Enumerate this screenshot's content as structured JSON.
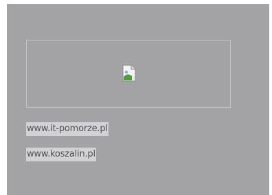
{
  "banner": {
    "image_icon": "broken-image-icon"
  },
  "links": [
    {
      "label": "www.it-pomorze.pl"
    },
    {
      "label": "www.koszalin.pl"
    }
  ],
  "colors": {
    "panel_background": "#a3a3a6",
    "link_highlight": "#d2d2d5",
    "link_text": "#4f4f55"
  }
}
